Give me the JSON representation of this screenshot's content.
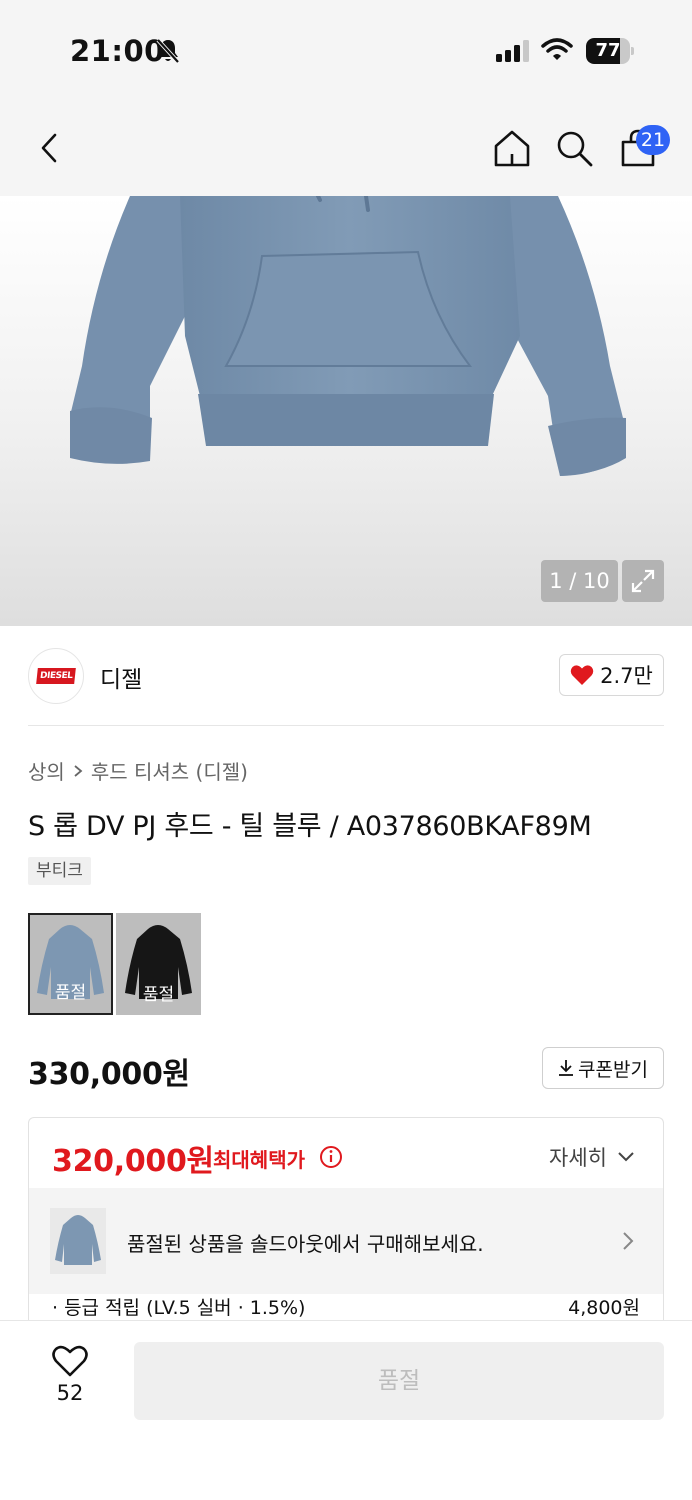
{
  "status_bar": {
    "time": "21:00",
    "battery_percent": 77,
    "battery_text": "77"
  },
  "top_nav": {
    "cart_count": "21",
    "icons": [
      "chevron-left-icon",
      "home-icon",
      "search-icon",
      "shopping-bag-icon"
    ]
  },
  "gallery": {
    "counter": "1 / 10",
    "product_color": "#7d97b2"
  },
  "brand": {
    "logo_text": "DIESEL",
    "name": "디젤",
    "likes": "2.7만"
  },
  "breadcrumb": {
    "category": "상의",
    "subcategory": "후드 티셔츠 (디젤)"
  },
  "product": {
    "title": "S 롭 DV PJ 후드 - 틸 블루 / A037860BKAF89M",
    "tag": "부티크",
    "color_options": [
      {
        "label": "품절",
        "color": "#7d97b2"
      },
      {
        "label": "품절",
        "color": "#161616"
      }
    ]
  },
  "price": {
    "original": "330,000원",
    "coupon_button": "쿠폰받기"
  },
  "benefit": {
    "best_price": "320,000원",
    "best_price_label": "최대혜택가",
    "detail_toggle": "자세히",
    "soldout_message": "품절된 상품을 솔드아웃에서 구매해보세요.",
    "points_label": "· 등급 적립 (LV.5 실버 · 1.5%)",
    "points_value": "4,800원"
  },
  "bottom_bar": {
    "wishlist_count": "52",
    "buy_button": "품절"
  },
  "colors": {
    "accent_red": "#e0191e",
    "badge_blue": "#2f63f5",
    "heart_red": "#e0191e"
  }
}
